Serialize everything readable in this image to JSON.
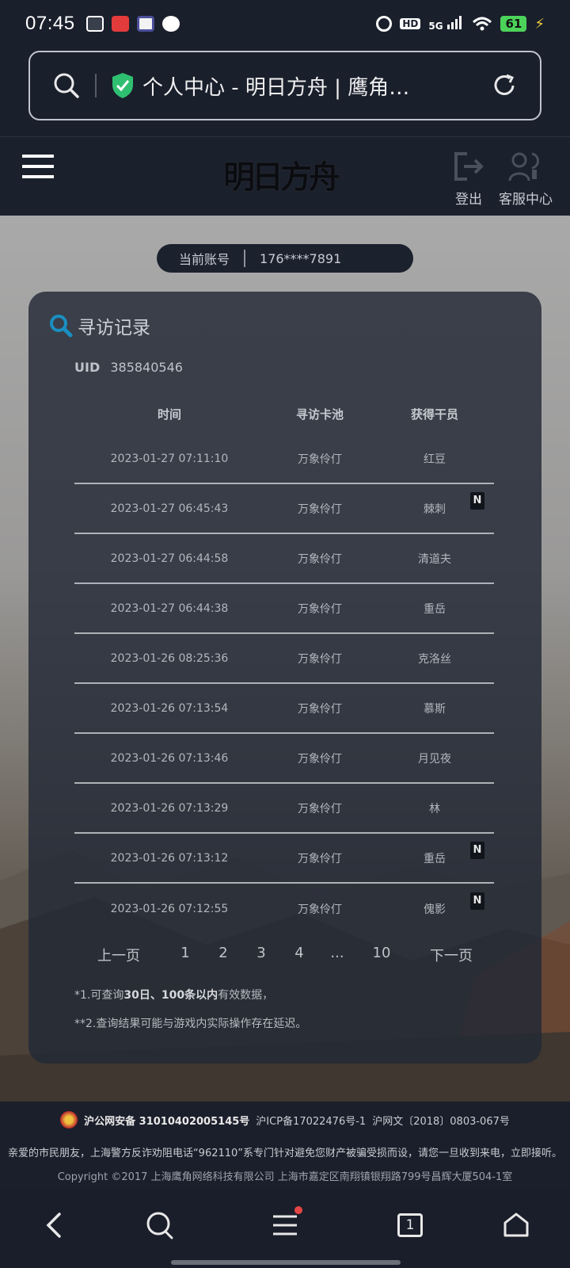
{
  "status_bar": {
    "time": "07:45",
    "network": "5G",
    "hd": "HD",
    "battery": "61"
  },
  "address_bar": {
    "page_title": "个人中心 - 明日方舟 | 鹰角…"
  },
  "header": {
    "logo_text": "明日方舟",
    "logout_label": "登出",
    "service_label": "客服中心"
  },
  "account": {
    "label": "当前账号",
    "value": "176****7891"
  },
  "records": {
    "title": "寻访记录",
    "uid_label": "UID",
    "uid_value": "385840546",
    "columns": [
      "时间",
      "寻访卡池",
      "获得干员"
    ],
    "rows": [
      {
        "time": "2023-01-27 07:11:10",
        "pool": "万象伶仃",
        "operator": "红豆",
        "new": false
      },
      {
        "time": "2023-01-27 06:45:43",
        "pool": "万象伶仃",
        "operator": "棘刺",
        "new": true
      },
      {
        "time": "2023-01-27 06:44:58",
        "pool": "万象伶仃",
        "operator": "清道夫",
        "new": false
      },
      {
        "time": "2023-01-27 06:44:38",
        "pool": "万象伶仃",
        "operator": "重岳",
        "new": false
      },
      {
        "time": "2023-01-26 08:25:36",
        "pool": "万象伶仃",
        "operator": "克洛丝",
        "new": false
      },
      {
        "time": "2023-01-26 07:13:54",
        "pool": "万象伶仃",
        "operator": "慕斯",
        "new": false
      },
      {
        "time": "2023-01-26 07:13:46",
        "pool": "万象伶仃",
        "operator": "月见夜",
        "new": false
      },
      {
        "time": "2023-01-26 07:13:29",
        "pool": "万象伶仃",
        "operator": "林",
        "new": false
      },
      {
        "time": "2023-01-26 07:13:12",
        "pool": "万象伶仃",
        "operator": "重岳",
        "new": true
      },
      {
        "time": "2023-01-26 07:12:55",
        "pool": "万象伶仃",
        "operator": "傀影",
        "new": true
      }
    ],
    "new_badge": "N",
    "pagination": {
      "prev": "上一页",
      "pages": [
        "1",
        "2",
        "3",
        "4",
        "...",
        "10"
      ],
      "next": "下一页"
    },
    "note1_prefix": "*1.可查询",
    "note1_bold": "30日、100条以内",
    "note1_suffix": "有效数据，",
    "note2": "**2.查询结果可能与游戏内实际操作存在延迟。"
  },
  "footer": {
    "police_record_label": "沪公网安备 31010402005145号",
    "icp": "沪ICP备17022476号-1",
    "culture": "沪网文〔2018〕0803-067号",
    "notice": "亲爱的市民朋友，上海警方反诈劝阻电话“962110”系专门针对避免您财产被骗受损而设，请您一旦收到来电，立即接听。",
    "copyright": "Copyright ©2017 上海鹰角网络科技有限公司  上海市嘉定区南翔镇银翔路799号昌辉大厦504-1室"
  },
  "nav": {
    "tab_count": "1"
  },
  "colors": {
    "page_bg": "#1c2130",
    "card_bg": "#222836",
    "accent_search": "#1a8fc0",
    "shield_green": "#2fbf71"
  }
}
